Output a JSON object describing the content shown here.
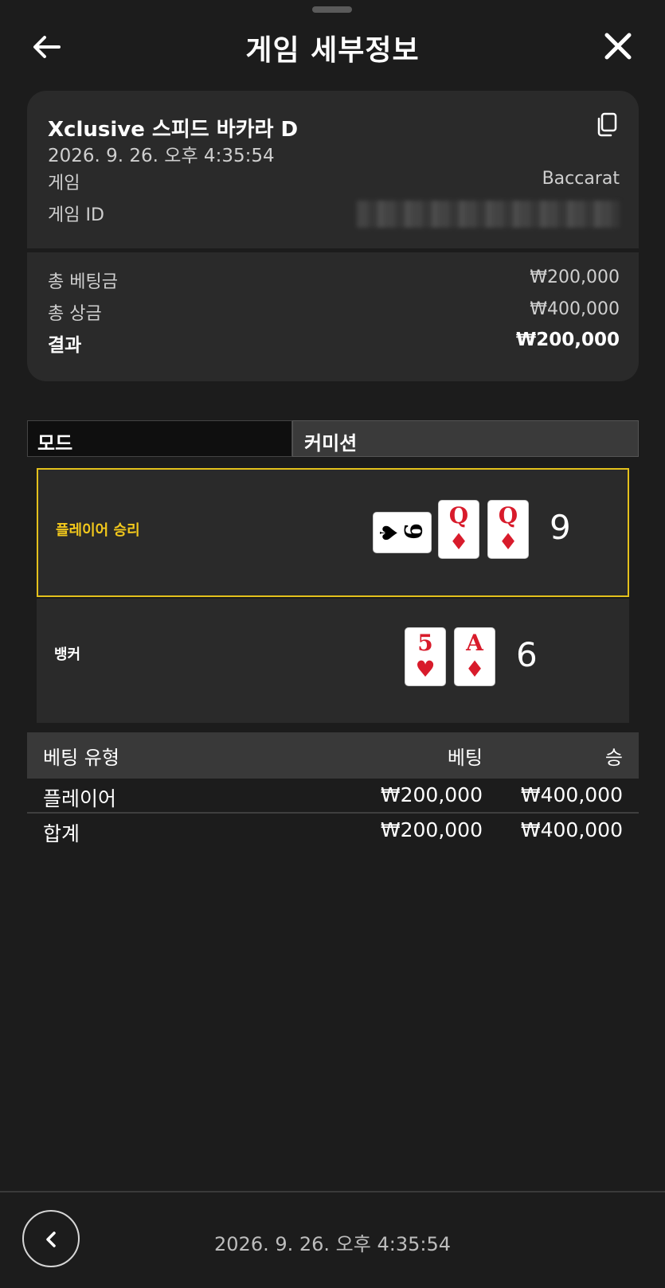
{
  "header": {
    "title": "게임 세부정보",
    "back_icon": "arrow-left-icon",
    "close_icon": "close-icon"
  },
  "info": {
    "game_name": "Xclusive 스피드 바카라 D",
    "datetime": "2026. 9. 26. 오후 4:35:54",
    "game_label": "게임",
    "game_value": "Baccarat",
    "game_id_label": "게임 ID",
    "copy_icon": "copy-icon"
  },
  "summary": {
    "total_bet_label": "총 베팅금",
    "total_bet_value": "₩200,000",
    "total_prize_label": "총 상금",
    "total_prize_value": "₩400,000",
    "result_label": "결과",
    "result_value": "₩200,000"
  },
  "mode": {
    "label": "모드",
    "value": "커미션"
  },
  "hands": {
    "player": {
      "label": "플레이어 승리",
      "score": "9",
      "cards": [
        {
          "rank": "9",
          "suit": "♠",
          "color": "black",
          "orientation": "horizontal"
        },
        {
          "rank": "Q",
          "suit": "♦",
          "color": "red",
          "orientation": "vertical"
        },
        {
          "rank": "Q",
          "suit": "♦",
          "color": "red",
          "orientation": "vertical"
        }
      ]
    },
    "banker": {
      "label": "뱅커",
      "score": "6",
      "cards": [
        {
          "rank": "5",
          "suit": "♥",
          "color": "red",
          "orientation": "vertical"
        },
        {
          "rank": "A",
          "suit": "♦",
          "color": "red",
          "orientation": "vertical"
        }
      ]
    }
  },
  "bets": {
    "headers": [
      "베팅 유형",
      "베팅",
      "승"
    ],
    "rows": [
      {
        "type": "플레이어",
        "bet": "₩200,000",
        "win": "₩400,000"
      },
      {
        "type": "합계",
        "bet": "₩200,000",
        "win": "₩400,000"
      }
    ]
  },
  "footer": {
    "datetime": "2026. 9. 26. 오후 4:35:54",
    "prev_icon": "chevron-left-icon"
  },
  "colors": {
    "background": "#1c1c1c",
    "card": "#2a2a2a",
    "highlight": "#e4c11c",
    "card_red": "#d81b2b"
  }
}
